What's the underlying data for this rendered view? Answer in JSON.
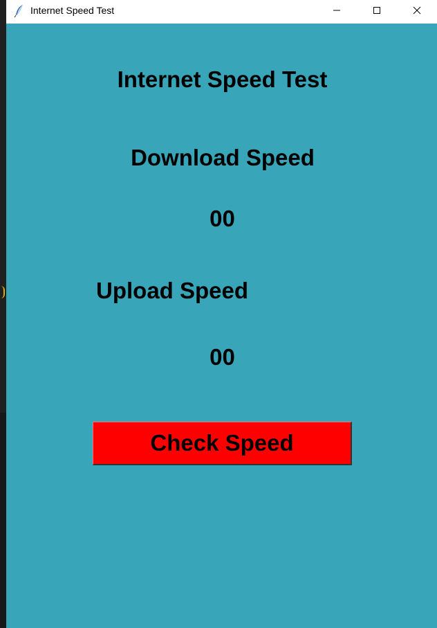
{
  "window": {
    "title": "Internet Speed Test",
    "app_icon": "feather-icon",
    "controls": {
      "minimize_icon": "minimize-icon",
      "maximize_icon": "maximize-icon",
      "close_icon": "close-icon"
    }
  },
  "main": {
    "title": "Internet Speed Test",
    "download": {
      "label": "Download Speed",
      "value": "00"
    },
    "upload": {
      "label": "Upload Speed",
      "value": "00"
    },
    "check_button_label": "Check Speed"
  },
  "colors": {
    "background": "#38a5b8",
    "button": "#ff0000",
    "text": "#000000",
    "titlebar": "#ffffff"
  }
}
